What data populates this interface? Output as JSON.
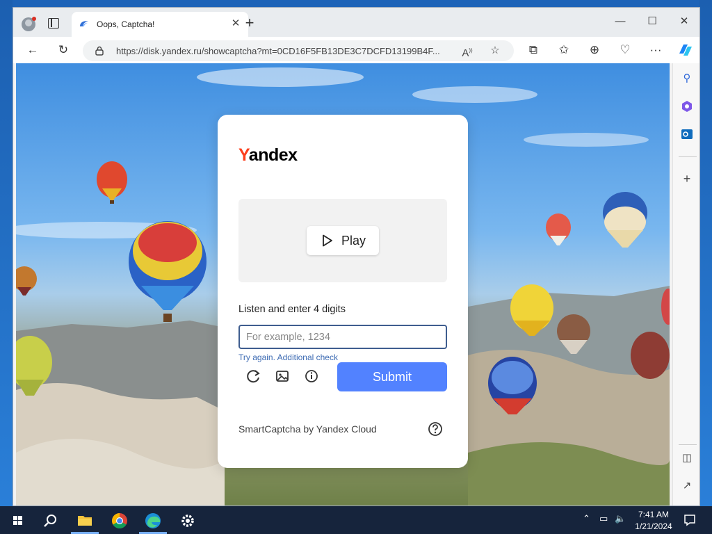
{
  "browser": {
    "tab_title": "Oops, Captcha!",
    "tab_close": "✕",
    "new_tab": "+",
    "url": "https://disk.yandex.ru/showcaptcha?mt=0CD16F5FB13DE3C7DCFD13199B4F...",
    "window_controls": {
      "minimize": "—",
      "maximize": "☐",
      "close": "✕"
    },
    "toolbar": {
      "back": "←",
      "reload": "↻",
      "split": "⧉",
      "favorites": "☆",
      "collections": "⊕",
      "more": "···"
    }
  },
  "captcha": {
    "logo_first": "Y",
    "logo_rest": "andex",
    "play_label": "Play",
    "prompt": "Listen and enter 4 digits",
    "input_placeholder": "For example, 1234",
    "input_value": "",
    "try_again": "Try again.",
    "additional_check": "Additional check",
    "submit_label": "Submit",
    "footer": "SmartCaptcha by Yandex Cloud"
  },
  "taskbar": {
    "time": "7:41 AM",
    "date": "1/21/2024"
  },
  "colors": {
    "accent": "#5282ff",
    "logo_red": "#fc3f1d",
    "link": "#3d6bb3",
    "taskbar": "#16243c"
  }
}
